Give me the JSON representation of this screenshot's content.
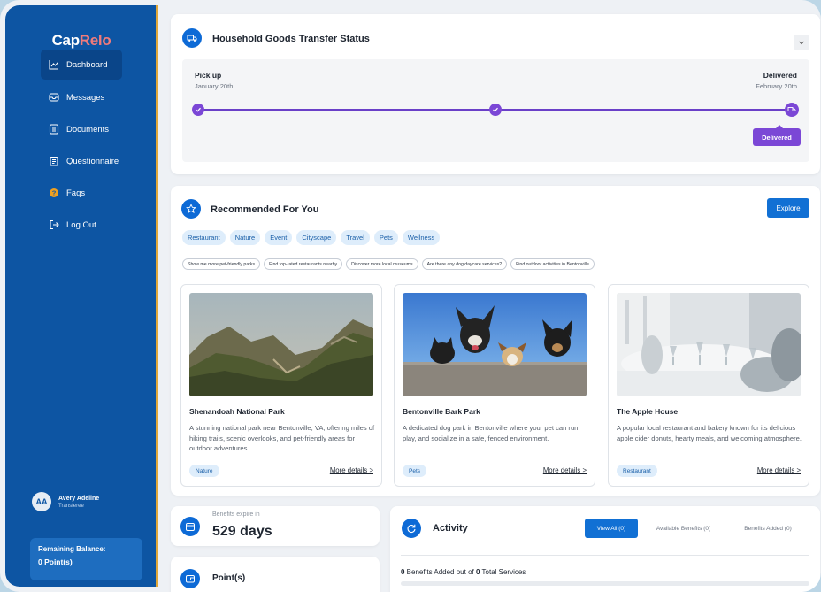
{
  "sidebar": {
    "logo_cap": "Cap",
    "logo_relo": "Relo",
    "items": [
      {
        "label": "Dashboard",
        "icon": "chart-line-icon",
        "active": true
      },
      {
        "label": "Messages",
        "icon": "inbox-icon"
      },
      {
        "label": "Documents",
        "icon": "document-icon"
      },
      {
        "label": "Questionnaire",
        "icon": "clipboard-icon"
      },
      {
        "label": "Faqs",
        "icon": "question-circle-icon"
      },
      {
        "label": "Log Out",
        "icon": "logout-icon"
      }
    ],
    "user": {
      "initials": "AA",
      "name": "Avery Adeline",
      "role": "Transferee"
    },
    "balance": {
      "label": "Remaining Balance:",
      "value": "0 Point(s)"
    }
  },
  "transfer": {
    "title": "Household Goods Transfer Status",
    "start_label": "Pick up",
    "start_date": "January 20th",
    "end_label": "Delivered",
    "end_date": "February 20th",
    "badge": "Delivered",
    "progress": 1.0
  },
  "recommended": {
    "title": "Recommended For You",
    "explore_label": "Explore",
    "tags": [
      "Restaurant",
      "Nature",
      "Event",
      "Cityscape",
      "Travel",
      "Pets",
      "Wellness"
    ],
    "prompts": [
      "Show me more pet-friendly parks",
      "Find top-rated restaurants nearby",
      "Discover more local museums",
      "Are there any dog daycare services?",
      "Find outdoor activities in Bentonville"
    ],
    "cards": [
      {
        "title": "Shenandoah National Park",
        "description": "A stunning national park near Bentonville, VA, offering miles of hiking trails, scenic overlooks, and pet-friendly areas for outdoor adventures.",
        "tag": "Nature",
        "link": "More details >"
      },
      {
        "title": "Bentonville Bark Park",
        "description": "A dedicated dog park in Bentonville where your pet can run, play, and socialize in a safe, fenced environment.",
        "tag": "Pets",
        "link": "More details >"
      },
      {
        "title": "The Apple House",
        "description": "A popular local restaurant and bakery known for its delicious apple cider donuts, hearty meals, and welcoming atmosphere.",
        "tag": "Restaurant",
        "link": "More details >"
      }
    ]
  },
  "benefits": {
    "label": "Benefits expire in",
    "value": "529 days"
  },
  "points": {
    "label": "Point(s)"
  },
  "activity": {
    "title": "Activity",
    "tabs": [
      "View All (0)",
      "Available Benefits (0)",
      "Benefits Added (0)"
    ],
    "summary_added": "0",
    "summary_mid": " Benefits Added out of ",
    "summary_total": "0",
    "summary_end": " Total Services"
  },
  "colors": {
    "sidebar": "#0d55a3",
    "accent": "#1170d4",
    "progress": "#7b47d6",
    "logo_accent": "#f07b7b"
  }
}
